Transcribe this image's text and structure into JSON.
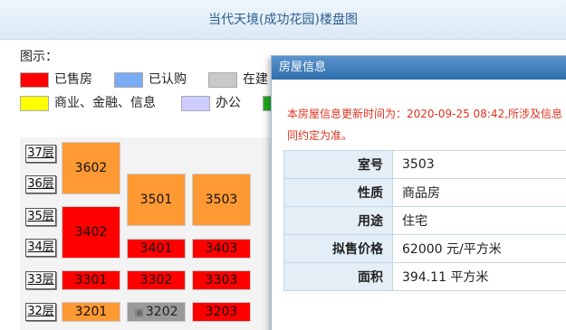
{
  "title": "当代天境(成功花园)楼盘图",
  "legend": {
    "label": "图示：",
    "items": [
      {
        "label": "已售房",
        "color": "#ff0000"
      },
      {
        "label": "已认购",
        "color": "#7aacf5"
      },
      {
        "label": "在建",
        "color": "#c8c8c8"
      },
      {
        "label": "商业、金融、信息",
        "color": "#ffff00"
      },
      {
        "label": "办公",
        "color": "#ccccff"
      },
      {
        "label": "",
        "color": "#22aa22"
      }
    ]
  },
  "floors": [
    "37层",
    "36层",
    "35层",
    "34层",
    "33层",
    "32层"
  ],
  "units": [
    {
      "room": "3602",
      "status": "orange"
    },
    {
      "room": "3501",
      "status": "orange"
    },
    {
      "room": "3503",
      "status": "orange"
    },
    {
      "room": "3402",
      "status": "sold"
    },
    {
      "room": "3401",
      "status": "sold"
    },
    {
      "room": "3403",
      "status": "sold"
    },
    {
      "room": "3301",
      "status": "sold"
    },
    {
      "room": "3302",
      "status": "sold"
    },
    {
      "room": "3303",
      "status": "sold"
    },
    {
      "room": "3201",
      "status": "orange"
    },
    {
      "room": "3202",
      "status": "building"
    },
    {
      "room": "3203",
      "status": "sold"
    }
  ],
  "dialog": {
    "title": "房屋信息",
    "notice": "本房屋信息更新时间为：2020-09-25 08:42,所涉及信息同约定为准。",
    "rows": [
      {
        "key": "室号",
        "value": "3503"
      },
      {
        "key": "性质",
        "value": "商品房"
      },
      {
        "key": "用途",
        "value": "住宅"
      },
      {
        "key": "拟售价格",
        "value": "62000 元/平方米"
      },
      {
        "key": "面积",
        "value": "394.11 平方米"
      }
    ]
  }
}
